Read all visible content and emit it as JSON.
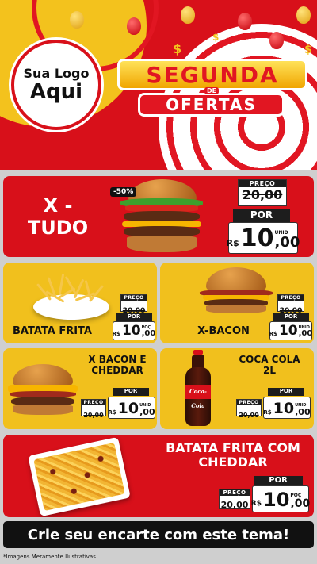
{
  "logo": {
    "line1": "Sua Logo",
    "line2": "Aqui"
  },
  "title": {
    "main": "SEGUNDA",
    "connector": "DE",
    "sub": "OFERTAS"
  },
  "decoration": {
    "dollar": "$"
  },
  "products": [
    {
      "name": "X - TUDO",
      "badge": "-50%",
      "price_label": "PREÇO",
      "old_price": "20,00",
      "por_label": "POR",
      "currency": "R$",
      "price_int": "10",
      "price_dec": ",00",
      "unit": "UNID"
    },
    {
      "name": "BATATA FRITA",
      "price_label": "PREÇO",
      "old_price": "20,00",
      "por_label": "POR",
      "currency": "R$",
      "price_int": "10",
      "price_dec": ",00",
      "unit": "POÇ"
    },
    {
      "name": "X-BACON",
      "price_label": "PREÇO",
      "old_price": "20,00",
      "por_label": "POR",
      "currency": "R$",
      "price_int": "10",
      "price_dec": ",00",
      "unit": "UNID"
    },
    {
      "name": "X BACON E CHEDDAR",
      "price_label": "PREÇO",
      "old_price": "20,00",
      "por_label": "POR",
      "currency": "R$",
      "price_int": "10",
      "price_dec": ",00",
      "unit": "UNID"
    },
    {
      "name": "COCA COLA 2L",
      "bottle_label": "Coca-Cola",
      "price_label": "PREÇO",
      "old_price": "20,00",
      "por_label": "POR",
      "currency": "R$",
      "price_int": "10",
      "price_dec": ",00",
      "unit": "UNID"
    },
    {
      "name": "BATATA FRITA COM CHEDDAR",
      "price_label": "PREÇO",
      "old_price": "20,00",
      "por_label": "POR",
      "currency": "R$",
      "price_int": "10",
      "price_dec": ",00",
      "unit": "POÇ"
    }
  ],
  "cta": "Crie seu encarte com este tema!",
  "footnote": "*Imagens Meramente Ilustrativas",
  "colors": {
    "red": "#d8101a",
    "yellow": "#f1c01d",
    "black": "#111111"
  }
}
